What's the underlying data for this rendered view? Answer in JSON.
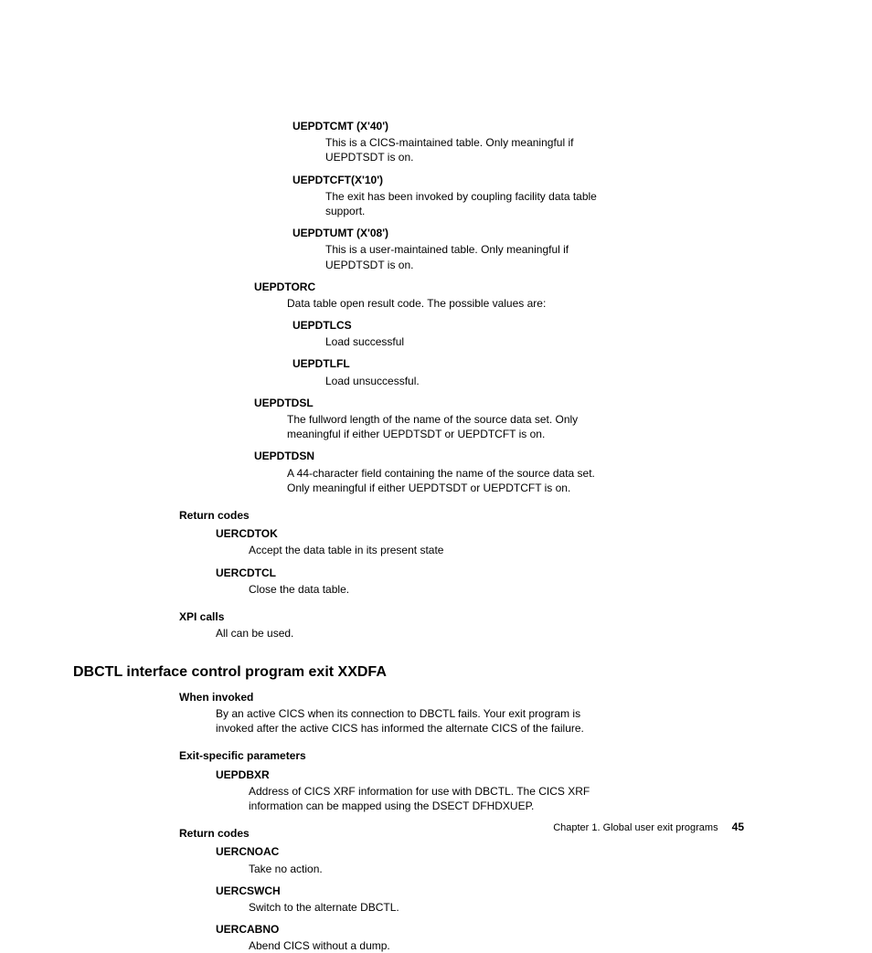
{
  "params_cont": {
    "uEPDTCMT": {
      "label": "UEPDTCMT (X'40')",
      "desc": "This is a CICS-maintained table. Only meaningful if UEPDTSDT is on."
    },
    "uEPDTCFT": {
      "label": "UEPDTCFT(X'10')",
      "desc": "The exit has been invoked by coupling facility data table support."
    },
    "uEPDTUMT": {
      "label": "UEPDTUMT (X'08')",
      "desc": "This is a user-maintained table. Only meaningful if UEPDTSDT is on."
    },
    "uEPDTORC": {
      "label": "UEPDTORC",
      "desc": "Data table open result code. The possible values are:",
      "sub1": {
        "label": "UEPDTLCS",
        "desc": "Load successful"
      },
      "sub2": {
        "label": "UEPDTLFL",
        "desc": "Load unsuccessful."
      }
    },
    "uEPDTDSL": {
      "label": "UEPDTDSL",
      "desc": "The fullword length of the name of the source data set. Only meaningful if either UEPDTSDT or UEPDTCFT is on."
    },
    "uEPDTDSN": {
      "label": "UEPDTDSN",
      "desc": "A 44-character field containing the name of the source data set. Only meaningful if either UEPDTSDT or UEPDTCFT is on."
    }
  },
  "return_codes1": {
    "label": "Return codes",
    "r1": {
      "label": "UERCDTOK",
      "desc": "Accept the data table in its present state"
    },
    "r2": {
      "label": "UERCDTCL",
      "desc": "Close the data table."
    }
  },
  "xpi": {
    "label": "XPI calls",
    "desc": "All can be used."
  },
  "heading": "DBCTL interface control program exit XXDFA",
  "when_invoked": {
    "label": "When invoked",
    "desc": "By an active CICS when its connection to DBCTL fails. Your exit program is invoked after the active CICS has informed the alternate CICS of the failure."
  },
  "exit_params": {
    "label": "Exit-specific parameters",
    "p1": {
      "label": "UEPDBXR",
      "desc": "Address of CICS XRF information for use with DBCTL. The CICS XRF information can be mapped using the DSECT DFHDXUEP."
    }
  },
  "return_codes2": {
    "label": "Return codes",
    "r1": {
      "label": "UERCNOAC",
      "desc": "Take no action."
    },
    "r2": {
      "label": "UERCSWCH",
      "desc": "Switch to the alternate DBCTL."
    },
    "r3": {
      "label": "UERCABNO",
      "desc": "Abend CICS without a dump."
    }
  },
  "footer": {
    "chapter": "Chapter 1. Global user exit programs",
    "page": "45"
  }
}
